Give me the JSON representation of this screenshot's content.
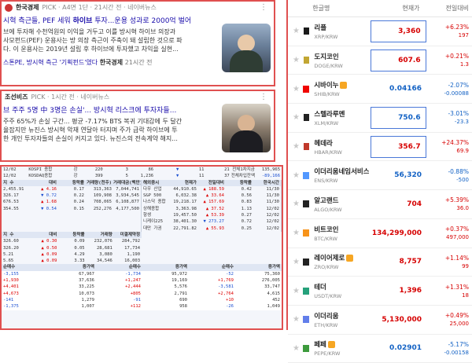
{
  "news": [
    {
      "source": "한국경제",
      "pick_info": "PICK · A4면 1단 · 21시간 전 · 네이버뉴스",
      "headline_pre": "시혁 측근들, PEF 세워 ",
      "headline_bold": "하이브",
      "headline_post": " 투자...운용 성과로 2000억 벌어",
      "body_lines": [
        "브에 투자해 수천억원의 이익을 거두고 이를 방시혁 하이브 의장과",
        "사모펀드(PEF) 운용사는 방 의장 측근이 주축이 돼 설립한 것으로 파",
        "다. 이 운용사는 2019년 설립 후 하이브에 투자했고 차익을 실현..."
      ],
      "related_title": "스톤PE, 방시혁 측근 '기획펀드'였다",
      "related_source": "한국경제",
      "related_time": "21시간 전"
    },
    {
      "source": "조선비즈",
      "pick_info": "PICK · 1시간 전 · 네이버뉴스",
      "headline_pre": "브 주주 5명 中 3명은 손실'... 방시혁 리스크에 투자자들...",
      "headline_bold": "",
      "headline_post": "",
      "body_lines": [
        "주주 65%가 손실 구간... 평균 -7.17% BTS 복귀 기대감에 두 달간",
        "율잡지만 뉴진스 방시혁 악재 연달아 터지며 주가 급락 하이브에 투",
        "한 개인 투자자들의 손실이 커지고 있다. 뉴진스의 전속계약 해지..."
      ]
    }
  ],
  "hts": {
    "top_rows": [
      [
        "12/02",
        "KOSPI 종합",
        "강",
        "220",
        "3",
        "86",
        "▼",
        "11",
        "21",
        "전체1차지금",
        "135,965"
      ],
      [
        "12/02",
        "KOSDAQ종합",
        "강",
        "399",
        "5",
        "1,236",
        "▼",
        "11",
        "37",
        "전체차입잔액",
        "-89,166"
      ]
    ],
    "left_head": [
      "지 수",
      "대비",
      "등락률",
      "거래량(천주)",
      "거래대금(백만)"
    ],
    "left_rows": [
      [
        "2,455.91",
        "▲ 4.16",
        "0.17",
        "313,363",
        "7,044,741"
      ],
      [
        "326.17",
        "▼ 0.72",
        "0.22",
        "109,908",
        "3,934,545"
      ],
      [
        "676.53",
        "▲ 1.68",
        "0.24",
        "708,065",
        "6,108,877"
      ],
      [
        "354.55",
        "▼ 0.54",
        "0.15",
        "252,276",
        "4,177,500"
      ]
    ],
    "world_head": [
      "해외증시",
      "현재가",
      "전일대비",
      "등락률",
      "한국시간"
    ],
    "world_rows": [
      [
        "다우 산업",
        "44,910.65",
        "▲ 188.59",
        "0.42",
        "11/30"
      ],
      [
        "S&P 500",
        "6,032.38",
        "▲ 33.64",
        "0.56",
        "11/30"
      ],
      [
        "나스닥 종합",
        "19,218.17",
        "▲ 157.69",
        "0.83",
        "11/30"
      ],
      [
        "상해종합",
        "3,363.98",
        "▲ 37.52",
        "1.13",
        "12/02"
      ],
      [
        "항셍",
        "19,457.50",
        "▲ 53.39",
        "0.27",
        "12/02"
      ],
      [
        "니케이225",
        "38,401.30",
        "▼ 273.27",
        "0.72",
        "12/02"
      ],
      [
        "대만 가권",
        "22,791.82",
        "▲ 55.93",
        "0.25",
        "12/02"
      ]
    ],
    "futures_head": [
      "지 수",
      "대비",
      "등락률",
      "거래량",
      "미결제약정"
    ],
    "futures_rows": [
      [
        "326.60",
        "▲ 0.30",
        "0.09",
        "232,076",
        "284,792"
      ],
      [
        "326.20",
        "▲ 0.50",
        "0.05",
        "28,681",
        "17,734"
      ],
      [
        "5.21",
        "▲ 0.09",
        "4.29",
        "3,080",
        "1,190"
      ],
      [
        "5.65",
        "▲ 0.09",
        "3.33",
        "34,546",
        "16,003"
      ]
    ],
    "bottom_head": [
      "순매수",
      "증가액",
      "순매수",
      "증가액",
      "순매수",
      "증가액"
    ],
    "bottom_rows": [
      [
        "-3,155",
        "67,967",
        "-1,734",
        "95,972",
        "-52",
        "75,360"
      ],
      [
        "+1,930",
        "37,636",
        "+1,247",
        "19,169",
        "+1,769",
        "276,005"
      ],
      [
        "+4,401",
        "33,225",
        "+2,444",
        "5,576",
        "-3,581",
        "33,747"
      ],
      [
        "+4,673",
        "10,073",
        "+805",
        "2,791",
        "+2,764",
        "4,615"
      ],
      [
        "-141",
        "1,279",
        "-91",
        "690",
        "+10",
        "452"
      ],
      [
        "-1,375",
        "1,007",
        "+112",
        "958",
        "-26",
        "1,049"
      ]
    ]
  },
  "crypto": {
    "columns": [
      "한글명",
      "현재가",
      "전일대비"
    ],
    "rows": [
      {
        "name": "리플",
        "pair": "XRP/KRW",
        "price": "3,360",
        "pct": "+6.23%",
        "abs": "197",
        "dir": "up",
        "boxed": true,
        "icon_color": "#1a1a1a",
        "icon": "ripple-icon",
        "badge": false
      },
      {
        "name": "도지코인",
        "pair": "DOGE/KRW",
        "price": "607.6",
        "pct": "+0.21%",
        "abs": "1.3",
        "dir": "up",
        "boxed": true,
        "icon_color": "#c2a633",
        "icon": "doge-icon",
        "badge": false
      },
      {
        "name": "시바이누",
        "pair": "SHIB/KRW",
        "price": "0.04166",
        "pct": "-2.07%",
        "abs": "-0.00088",
        "dir": "down",
        "boxed": false,
        "icon_color": "#f00500",
        "icon": "shiba-icon",
        "badge": true
      },
      {
        "name": "스텔라루멘",
        "pair": "XLM/KRW",
        "price": "750.6",
        "pct": "-3.01%",
        "abs": "-23.3",
        "dir": "down",
        "boxed": true,
        "icon_color": "#222222",
        "icon": "stellar-icon",
        "badge": false
      },
      {
        "name": "헤데라",
        "pair": "HBAR/KRW",
        "price": "356.7",
        "pct": "+24.37%",
        "abs": "69.9",
        "dir": "up",
        "boxed": true,
        "icon_color": "#c0392b",
        "icon": "hedera-icon",
        "badge": false
      },
      {
        "name": "이더리움네임서비스",
        "pair": "ENS/KRW",
        "price": "56,320",
        "pct": "-0.88%",
        "abs": "-500",
        "dir": "down",
        "boxed": false,
        "icon_color": "#5298ff",
        "icon": "ens-icon",
        "badge": false
      },
      {
        "name": "알고랜드",
        "pair": "ALGO/KRW",
        "price": "704",
        "pct": "+5.39%",
        "abs": "36.0",
        "dir": "up",
        "boxed": false,
        "icon_color": "#222222",
        "icon": "algorand-icon",
        "badge": false
      },
      {
        "name": "비트코인",
        "pair": "BTC/KRW",
        "price": "134,299,000",
        "pct": "+0.37%",
        "abs": "497,000",
        "dir": "up",
        "boxed": false,
        "icon_color": "#f7931a",
        "icon": "bitcoin-icon",
        "badge": false
      },
      {
        "name": "레이어제로",
        "pair": "ZRO/KRW",
        "price": "8,757",
        "pct": "+1.14%",
        "abs": "99",
        "dir": "up",
        "boxed": false,
        "icon_color": "#222222",
        "icon": "layerzero-icon",
        "badge": true
      },
      {
        "name": "테더",
        "pair": "USDT/KRW",
        "price": "1,396",
        "pct": "+1.31%",
        "abs": "18",
        "dir": "up",
        "boxed": false,
        "icon_color": "#26a17b",
        "icon": "tether-icon",
        "badge": false
      },
      {
        "name": "이더리움",
        "pair": "ETH/KRW",
        "price": "5,130,000",
        "pct": "+0.49%",
        "abs": "25,000",
        "dir": "up",
        "boxed": false,
        "icon_color": "#627eea",
        "icon": "ethereum-icon",
        "badge": false
      },
      {
        "name": "페페",
        "pair": "PEPE/KRW",
        "price": "0.02901",
        "pct": "-5.17%",
        "abs": "-0.00158",
        "dir": "down",
        "boxed": false,
        "icon_color": "#3d9b3d",
        "icon": "pepe-icon",
        "badge": true
      }
    ]
  },
  "colors": {
    "accent_border": "#e05050",
    "up": "#d60000",
    "down": "#1261c4",
    "price_box": "#4a78d8"
  }
}
